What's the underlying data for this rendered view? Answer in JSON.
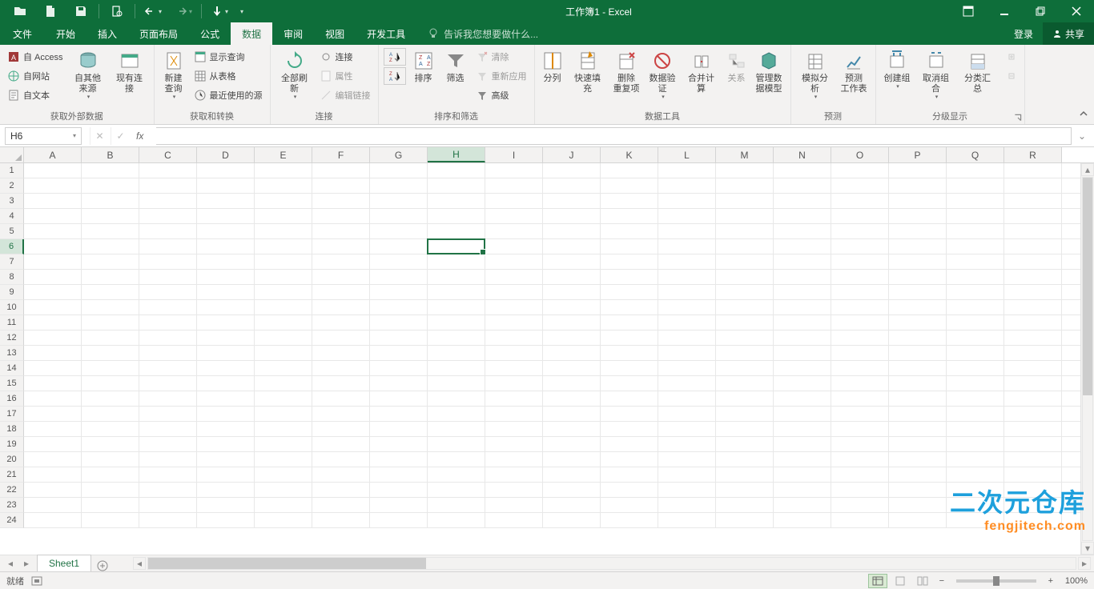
{
  "app": {
    "title": "工作簿1 - Excel"
  },
  "qat": {
    "items": [
      "open",
      "new",
      "save",
      "print-preview"
    ],
    "undo": "undo",
    "redo": "redo",
    "touch": "touch-mode"
  },
  "tabs": {
    "file": "文件",
    "list": [
      "开始",
      "插入",
      "页面布局",
      "公式",
      "数据",
      "审阅",
      "视图",
      "开发工具"
    ],
    "activeIndex": 4,
    "tellme": "告诉我您想要做什么...",
    "login": "登录",
    "share": "共享"
  },
  "ribbon": {
    "group_external": {
      "label": "获取外部数据",
      "access": "自 Access",
      "web": "自网站",
      "text": "自文本",
      "other": "自其他来源",
      "existing": "现有连接"
    },
    "group_transform": {
      "label": "获取和转换",
      "newquery": "新建\n查询",
      "showquery": "显示查询",
      "fromtable": "从表格",
      "recent": "最近使用的源"
    },
    "group_conn": {
      "label": "连接",
      "refreshall": "全部刷新",
      "connections": "连接",
      "properties": "属性",
      "editlinks": "编辑链接"
    },
    "group_sort": {
      "label": "排序和筛选",
      "sortaz": "A→Z",
      "sortza": "Z→A",
      "sort": "排序",
      "filter": "筛选",
      "clear": "清除",
      "reapply": "重新应用",
      "advanced": "高级"
    },
    "group_tools": {
      "label": "数据工具",
      "texttocol": "分列",
      "flashfill": "快速填充",
      "dedupe": "删除\n重复项",
      "validation": "数据验\n证",
      "consolidate": "合并计算",
      "relations": "关系",
      "model": "管理数\n据模型"
    },
    "group_forecast": {
      "label": "预测",
      "whatif": "模拟分析",
      "forecast": "预测\n工作表"
    },
    "group_outline": {
      "label": "分级显示",
      "group": "创建组",
      "ungroup": "取消组合",
      "subtotal": "分类汇总"
    }
  },
  "formula": {
    "namebox": "H6",
    "fx": "fx"
  },
  "grid": {
    "columns": [
      "A",
      "B",
      "C",
      "D",
      "E",
      "F",
      "G",
      "H",
      "I",
      "J",
      "K",
      "L",
      "M",
      "N",
      "O",
      "P",
      "Q",
      "R"
    ],
    "rows": 24,
    "active": {
      "row": 6,
      "colIndex": 7
    }
  },
  "sheets": {
    "active": "Sheet1"
  },
  "status": {
    "ready": "就绪",
    "zoom": "100%"
  },
  "watermark": {
    "l1": "二次元仓库",
    "l2": "fengjitech.com"
  }
}
